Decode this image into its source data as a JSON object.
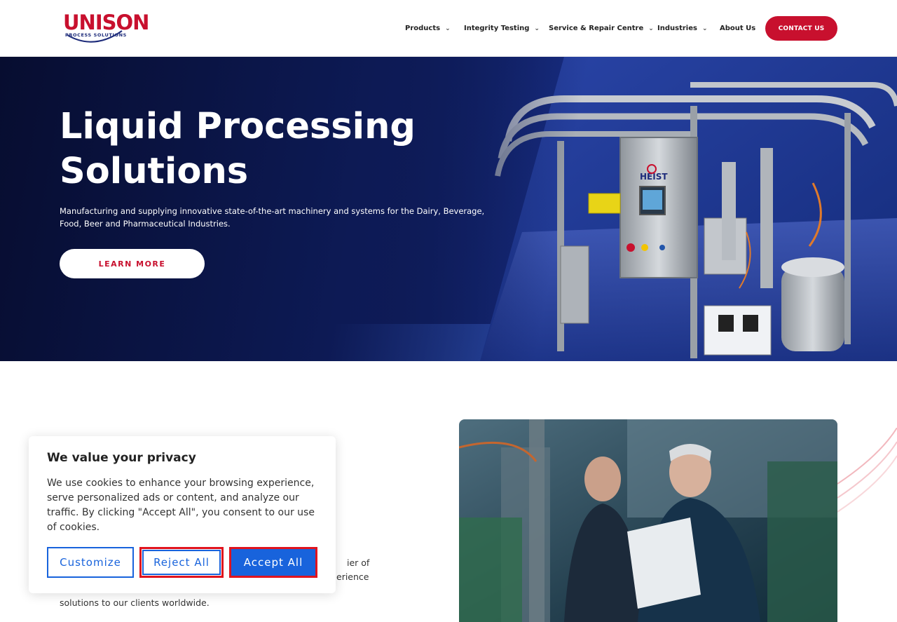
{
  "header": {
    "logo_text": "UNISON",
    "logo_sub": "PROCESS SOLUTIONS",
    "nav": [
      {
        "label": "Products",
        "has_dropdown": true
      },
      {
        "label": "Integrity Testing",
        "has_dropdown": true
      },
      {
        "label": "Service & Repair Centre",
        "has_dropdown": true
      },
      {
        "label": "Industries",
        "has_dropdown": true
      },
      {
        "label": "About Us",
        "has_dropdown": false
      }
    ],
    "contact_label": "CONTACT US"
  },
  "hero": {
    "title_line1": "Liquid Processing",
    "title_line2": "Solutions",
    "subtitle": "Manufacturing and supplying innovative state-of-the-art machinery and systems for the Dairy, Beverage, Food, Beer and Pharmaceutical Industries.",
    "button_label": "LEARN MORE",
    "machine_badge": "HEIST"
  },
  "about": {
    "text_fragment_1": "ier of",
    "text_fragment_2": "erience",
    "text_last_line": "solutions to our clients worldwide."
  },
  "cookie": {
    "title": "We value your privacy",
    "body": "We use cookies to enhance your browsing experience, serve personalized ads or content, and analyze our traffic. By clicking \"Accept All\", you consent to our use of cookies.",
    "customize_label": "Customize",
    "reject_label": "Reject All",
    "accept_label": "Accept All"
  },
  "colors": {
    "brand_red": "#c8102e",
    "brand_navy": "#1d2b7a",
    "cookie_blue": "#1863dc",
    "highlight_red": "#e0141e"
  },
  "icons": {
    "nav_dropdown": "chevron-down-icon"
  }
}
